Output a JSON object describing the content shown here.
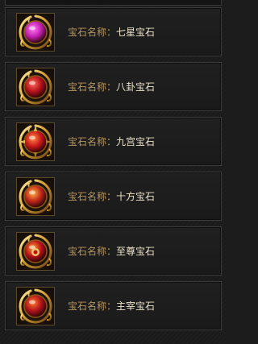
{
  "label_prefix": "宝石名称：",
  "gems": [
    {
      "name": "七星宝石",
      "icon": "seven-star-gem-icon",
      "core": "#c21fb0",
      "glow": "#ff7cf0"
    },
    {
      "name": "八卦宝石",
      "icon": "bagua-gem-icon",
      "core": "#b3121a",
      "glow": "#ff6a5a"
    },
    {
      "name": "九宫宝石",
      "icon": "nine-palace-gem-icon",
      "core": "#c8161a",
      "glow": "#ff8a40"
    },
    {
      "name": "十方宝石",
      "icon": "ten-direction-gem-icon",
      "core": "#c0261a",
      "glow": "#ffb040"
    },
    {
      "name": "至尊宝石",
      "icon": "supreme-gem-icon",
      "core": "#b8121a",
      "glow": "#ff9a30"
    },
    {
      "name": "主宰宝石",
      "icon": "dominator-gem-icon",
      "core": "#b0141a",
      "glow": "#ff7a30"
    }
  ]
}
